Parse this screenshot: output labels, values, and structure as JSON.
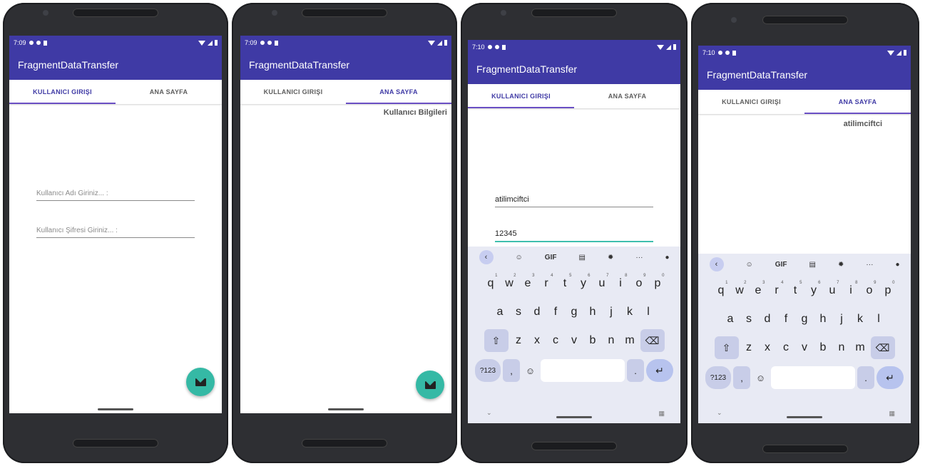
{
  "status": {
    "time1": "7:09",
    "time2": "7:09",
    "time3": "7:10",
    "time4": "7:10"
  },
  "app": {
    "title": "FragmentDataTransfer"
  },
  "tabs": {
    "login": "KULLANICI GIRIŞI",
    "home": "ANA SAYFA"
  },
  "login": {
    "username_placeholder": "Kullanıcı Adı Giriniz... :",
    "password_placeholder": "Kullanıcı Şifresi Giriniz... :",
    "username_value": "atilimciftci",
    "password_value": "12345"
  },
  "home": {
    "info_label": "Kullanıcı Bilgileri",
    "received_value": "atilimciftci"
  },
  "keyboard": {
    "gif": "GIF",
    "more": "···",
    "row1": [
      "q",
      "w",
      "e",
      "r",
      "t",
      "y",
      "u",
      "i",
      "o",
      "p"
    ],
    "row1_nums": [
      "1",
      "2",
      "3",
      "4",
      "5",
      "6",
      "7",
      "8",
      "9",
      "0"
    ],
    "row2": [
      "a",
      "s",
      "d",
      "f",
      "g",
      "h",
      "j",
      "k",
      "l"
    ],
    "row3": [
      "z",
      "x",
      "c",
      "v",
      "b",
      "n",
      "m"
    ],
    "sym": "?123",
    "comma": ",",
    "period": "."
  },
  "colors": {
    "primary": "#3f3aa5",
    "accent": "#35b9a5",
    "tab_indicator": "#6a4fc4"
  },
  "icons": {
    "fab": "mail-icon",
    "shift": "shift-icon",
    "backspace": "backspace-icon",
    "enter": "enter-icon",
    "emoji": "emoji-icon",
    "mic": "mic-icon",
    "settings": "gear-icon",
    "clipboard": "clipboard-icon",
    "sticker": "sticker-icon",
    "back": "chevron-left-icon"
  }
}
